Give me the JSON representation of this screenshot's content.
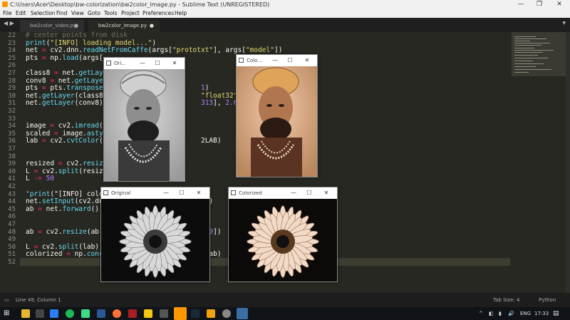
{
  "window": {
    "title": "C:\\Users\\Acer\\Desktop\\bw-colorization\\bw2color_image.py - Sublime Text (UNREGISTERED)",
    "minimize": "—",
    "maximize": "❐",
    "close": "✕"
  },
  "menu": [
    "File",
    "Edit",
    "Selection",
    "Find",
    "View",
    "Goto",
    "Tools",
    "Project",
    "Preferences",
    "Help"
  ],
  "tabs": [
    {
      "label": "bw2color_video.py",
      "active": false
    },
    {
      "label": "bw2color_image.py",
      "active": true
    }
  ],
  "editor": {
    "line_numbers": [
      "22",
      "23",
      "24",
      "25",
      "26",
      "27",
      "28",
      "29",
      "30",
      "31",
      "32",
      "33",
      "34",
      "35",
      "36",
      "37",
      "38",
      "39",
      "40",
      "41",
      "42",
      "43",
      "44",
      "45",
      "46",
      "47",
      "48",
      "49",
      "50",
      "51",
      "52"
    ],
    "lines": [
      "# center points from disk",
      "print(\"[INFO] loading model...\")",
      "net = cv2.dnn.readNetFromCaffe(args[\"prototxt\"], args[\"model\"])",
      "pts = np.load(args[",
      "",
      "class8 = net.getLaye",
      "conv8 = net.getLayer",
      "pts = pts.transpose(                       1)",
      "net.getLayer(class8)                       \"float32\")]",
      "net.getLayer(conv8).                       313], 2.606,",
      "",
      "",
      "image = cv2.imread(a",
      "scaled = image.astyp",
      "lab = cv2.cvtColor(s                       2LAB)",
      "",
      "",
      "resized = cv2.resize",
      "L = cv2.split(resized)[0]",
      "L -= 50",
      "",
      "'print(\"[INFO] color",
      "net.setInput(cv2.dn                        0))",
      "ab = net.forward()[",
      "",
      "",
      "ab = cv2.resize(ab,                        e[0])",
      "",
      "L = cv2.split(lab)[",
      "colorized = np.conc                        , ab)",
      ""
    ]
  },
  "windows": [
    {
      "title": "Ori...",
      "image": "grayscale-portrait"
    },
    {
      "title": "Colo...",
      "image": "colorized-portrait"
    },
    {
      "title": "Original",
      "image": "grayscale-sunflower"
    },
    {
      "title": "Colorized",
      "image": "colorized-sunflower"
    }
  ],
  "status": {
    "position": "Line 49, Column 1",
    "tab_size": "Tab Size: 4",
    "syntax": "Python"
  },
  "taskbar": {
    "language": "ENG",
    "time": "17:33",
    "up_arrow": "^",
    "speaker": "🔊"
  },
  "colors": {
    "editor_bg": "#272822",
    "taskbar_bg": "#101418"
  }
}
